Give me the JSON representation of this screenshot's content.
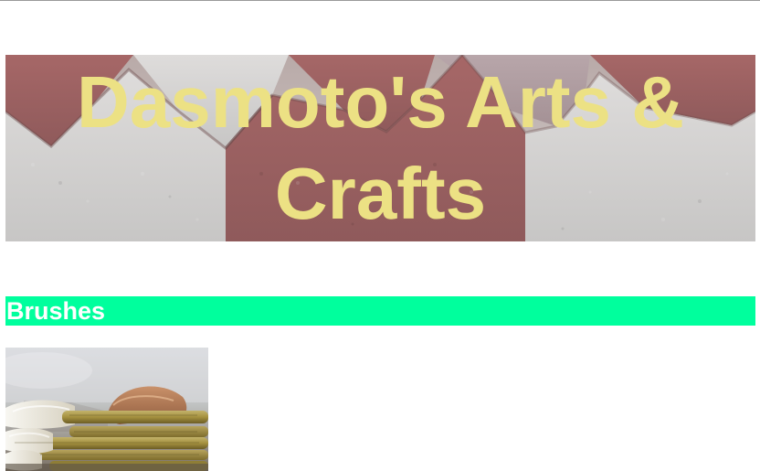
{
  "header": {
    "title": "Dasmoto's Arts & Crafts"
  },
  "sections": [
    {
      "heading": "Brushes"
    }
  ],
  "colors": {
    "title_text": "#ece184",
    "section_heading_background": "#00ff9d",
    "section_heading_text": "#ffffff"
  }
}
